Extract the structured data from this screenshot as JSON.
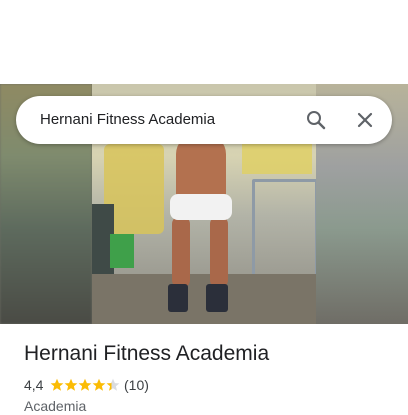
{
  "search": {
    "query": "Hernani Fitness Academia"
  },
  "place": {
    "title": "Hernani Fitness Academia",
    "rating": "4,4",
    "rating_stars": 4.4,
    "review_count": "(10)",
    "category": "Academia"
  },
  "colors": {
    "star": "#fbbc04",
    "icon": "#5f6368",
    "text": "#202124"
  },
  "icons": {
    "search": "search-icon",
    "close": "close-icon",
    "star": "star-icon"
  }
}
